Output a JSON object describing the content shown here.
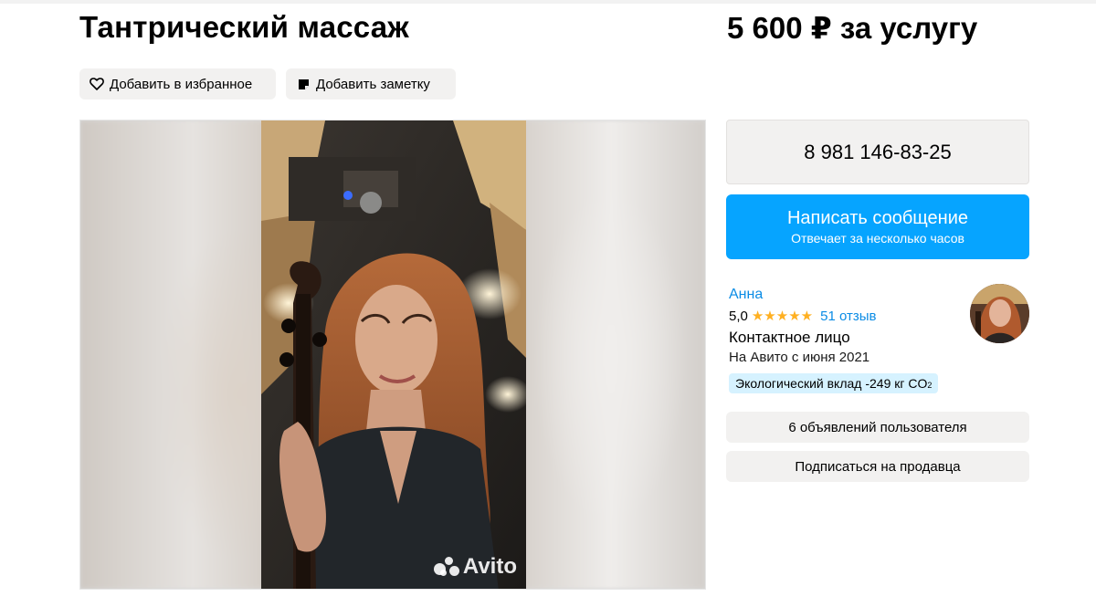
{
  "listing": {
    "title": "Тантрический массаж",
    "price": "5 600 ₽ за услугу"
  },
  "actions": {
    "favorite_label": "Добавить в избранное",
    "note_label": "Добавить заметку"
  },
  "gallery": {
    "watermark": "Avito"
  },
  "contact": {
    "phone": "8 981 146-83-25",
    "message_label": "Написать сообщение",
    "message_sub": "Отвечает за несколько часов"
  },
  "seller": {
    "name": "Анна",
    "rating": "5,0",
    "stars": "★★★★★",
    "reviews": "51 отзыв",
    "role": "Контактное лицо",
    "since": "На Авито с июня 2021",
    "eco_prefix": "Экологический вклад -249 кг CO",
    "eco_sub": "2",
    "ads_button": "6 объявлений пользователя",
    "subscribe_button": "Подписаться на продавца"
  },
  "colors": {
    "accent": "#06a4ff",
    "link": "#0b8ce5",
    "star": "#ffb021",
    "chip_bg": "#f2f1f0",
    "eco_bg": "#d6f2ff"
  },
  "icons": {
    "favorite": "heart-outline-icon",
    "note": "note-icon",
    "watermark_logo": "avito-logo-icon"
  }
}
